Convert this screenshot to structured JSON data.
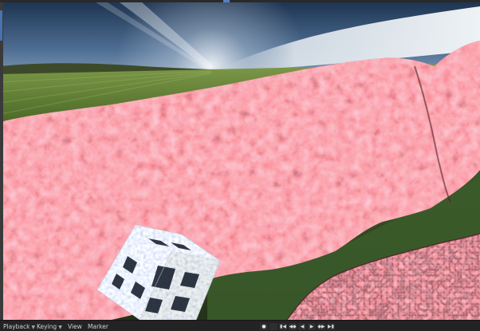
{
  "timeline": {
    "menus": [
      {
        "label": "Playback"
      },
      {
        "label": "Keying"
      },
      {
        "label": "View"
      },
      {
        "label": "Marker"
      }
    ],
    "controls": {
      "record_icon": "record-dot-icon",
      "jump_start_icon": "jump-to-start-icon",
      "prev_key_icon": "previous-keyframe-icon",
      "play_reverse_icon": "play-reverse-icon",
      "play_icon": "play-icon",
      "next_key_icon": "next-keyframe-icon",
      "jump_end_icon": "jump-to-end-icon"
    }
  },
  "colors": {
    "ui_dark": "#232323",
    "accent": "#4772b3",
    "terrain": "#b44a52",
    "sky": "#3d5a7a",
    "grass": "#5f7a35"
  }
}
